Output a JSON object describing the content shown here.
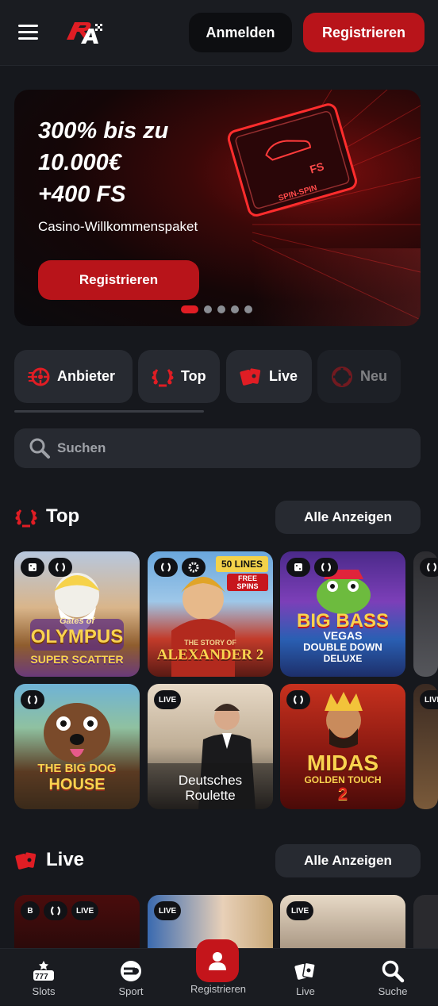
{
  "header": {
    "login_label": "Anmelden",
    "register_label": "Registrieren"
  },
  "hero": {
    "line1": "300% bis zu",
    "line2": "10.000€",
    "line3": "+400 FS",
    "subtitle": "Casino-Willkommenspaket",
    "cta_label": "Registrieren",
    "slides": 5,
    "active_slide": 1
  },
  "categories": [
    {
      "label": "Anbieter",
      "icon": "provider-icon"
    },
    {
      "label": "Top",
      "icon": "laurel-icon"
    },
    {
      "label": "Live",
      "icon": "cards-icon"
    },
    {
      "label": "Neu",
      "icon": "new-icon"
    }
  ],
  "search": {
    "placeholder": "Suchen"
  },
  "top_section": {
    "title": "Top",
    "all_label": "Alle Anzeigen",
    "games": [
      {
        "title": "Gates of Olympus Super Scatter",
        "badges": [
          "dice",
          "laurel"
        ]
      },
      {
        "title": "The Story of Alexander 2",
        "badges": [
          "laurel",
          "gear"
        ]
      },
      {
        "title": "Big Bass Vegas Double Down Deluxe",
        "badges": [
          "dice",
          "laurel"
        ]
      },
      {
        "title": "The Big Dog House",
        "badges": [
          "laurel"
        ]
      },
      {
        "title": "Deutsches Roulette",
        "badges": [
          "LIVE"
        ]
      },
      {
        "title": "Midas Golden Touch 2",
        "badges": [
          "laurel"
        ]
      }
    ],
    "tile_texts": {
      "olympus_1": "Gates of",
      "olympus_2": "OLYMPUS",
      "olympus_3": "SUPER SCATTER",
      "alex_lines": "50 LINES",
      "alex_free": "FREE SPINS",
      "alex_1": "THE STORY OF",
      "alex_2": "ALEXANDER 2",
      "bass_1": "BIG BASS",
      "bass_2": "VEGAS",
      "bass_3": "DOUBLE DOWN",
      "bass_4": "DELUXE",
      "dog_1": "THE BIG DOG",
      "dog_2": "HOUSE",
      "roulette_1": "Deutsches",
      "roulette_2": "Roulette",
      "midas_1": "MIDAS",
      "midas_2": "GOLDEN TOUCH",
      "midas_3": "2"
    }
  },
  "live_section": {
    "title": "Live",
    "all_label": "Alle Anzeigen",
    "live_badge": "LIVE",
    "coin_badge": "B"
  },
  "bottom_nav": [
    {
      "label": "Slots",
      "icon": "slots-icon"
    },
    {
      "label": "Sport",
      "icon": "sport-icon"
    },
    {
      "label": "Registrieren",
      "icon": "user-icon"
    },
    {
      "label": "Live",
      "icon": "cards-icon"
    },
    {
      "label": "Suche",
      "icon": "search-icon"
    }
  ],
  "colors": {
    "background": "#16181d",
    "surface": "#272a31",
    "accent_red": "#b8141a",
    "text_muted": "#9ea1a7"
  }
}
